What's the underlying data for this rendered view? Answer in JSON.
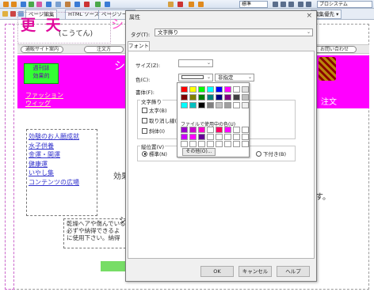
{
  "toolbar": {
    "mode_combo": "標準",
    "right_combo": "プロシステム"
  },
  "tabs": [
    {
      "label": "ページ編集"
    },
    {
      "label": "HTML ソース"
    },
    {
      "label": "ページソース"
    }
  ],
  "tabbar_right": "編集優先 ▾",
  "page": {
    "logo_main": "更 天",
    "logo_kana": "(こうてん)",
    "logo_right": "シ",
    "nav": [
      "通販サイト案内",
      "注文方",
      "お問い合わせ"
    ],
    "green_label": "週刊誌\n効果的",
    "banner_text": "シ",
    "sub_left": "ファッション\nウィッグ",
    "sub_right": "注文",
    "side_links": [
      "効験のお人願成就",
      "水子供養",
      "金運・開運",
      "健康運",
      "いやし集",
      "コンテンツの広場"
    ],
    "main_frag_1": "効果",
    "main_frag_2": "す。",
    "main_frag_3": "シ",
    "bottom_text": [
      "乾燥へアや傷んでいる",
      "必ずや納得できるよ",
      "に使用下さい。納得"
    ]
  },
  "dialog": {
    "title": "属性",
    "tag_label": "タグ(T):",
    "tag_value": "文字飾り",
    "font_tab": "フォント",
    "size_label": "サイズ(Z):",
    "color_label": "色(C):",
    "color_name": "非指定",
    "face_label": "書体(F):",
    "deco_label": "文字飾り",
    "bold": "太字(B)",
    "strike": "取り消し線(K)",
    "italic": "斜体(I)",
    "valign_label": "縦位置(V)",
    "standard": "標準(N)",
    "subscript": "下付き(B)",
    "ok": "OK",
    "cancel": "キャンセル",
    "help": "ヘルプ"
  },
  "color_popup": {
    "used_label": "ファイルで使用中の色(U)",
    "other_button": "その他(O)..."
  },
  "palette": {
    "standard_colors": [
      "#ff0000",
      "#ffff00",
      "#00ff00",
      "#00ffff",
      "#0000ff",
      "#ff00ff",
      "#ffffff",
      "#e0e0e0",
      "#800000",
      "#808000",
      "#008000",
      "#008080",
      "#000080",
      "#800080",
      "#404040",
      "#c0c0c0",
      "#00ffff",
      "#00c0c0",
      "#000000",
      "#808080",
      "#c0c0c0",
      "#a0a0a0",
      "#ffffff",
      "#f0f0f0"
    ],
    "used_colors": [
      "#9900cc",
      "#cc00cc",
      "#ff00cc",
      "#ffffff",
      "#ff0066",
      "#ff00ff",
      "#ffffff",
      "#ffffff",
      "#cc00ff",
      "#ff00ff",
      "#660099",
      "#ffffff",
      "#ffffff",
      "#ffffff",
      "#ffffff",
      "#ffffff",
      "#ffffff",
      "#ffffff",
      "#ffffff",
      "#ffffff",
      "#ffffff",
      "#ffffff",
      "#ffffff",
      "#ffffff"
    ]
  }
}
